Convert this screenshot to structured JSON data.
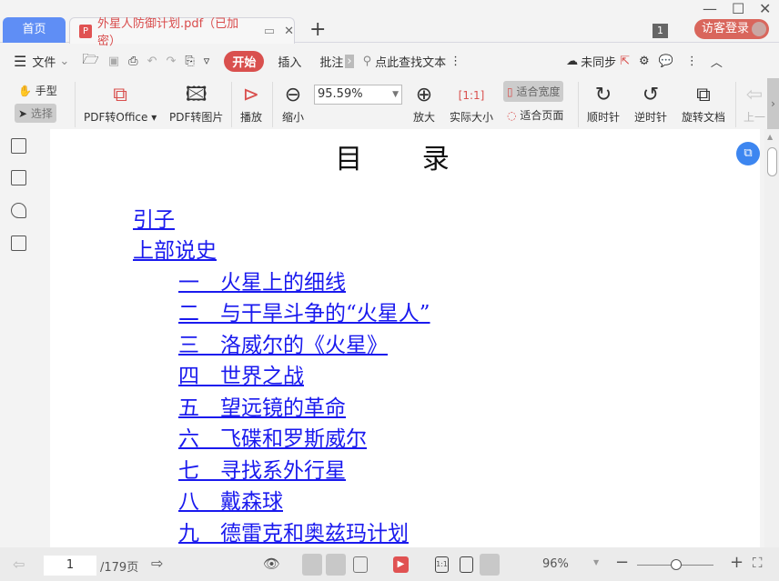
{
  "tabs": {
    "home": "首页",
    "doc": "外星人防御计划.pdf（已加密）",
    "new": "+"
  },
  "titlebar": {
    "badge": "1",
    "login": "访客登录"
  },
  "menu": {
    "file": "文件",
    "start": "开始",
    "insert": "插入",
    "annotate": "批注",
    "search": "点此查找文本",
    "sync": "未同步"
  },
  "ribbon": {
    "hand": "手型",
    "select": "选择",
    "pdf_office": "PDF转Office",
    "pdf_image": "PDF转图片",
    "play": "播放",
    "zoom_out": "缩小",
    "zoom_value": "95.59%",
    "zoom_in": "放大",
    "actual_size": "实际大小",
    "fit_width": "适合宽度",
    "fit_page": "适合页面",
    "clockwise": "顺时针",
    "counter_clockwise": "逆时针",
    "rotate_doc": "旋转文档",
    "prev": "上一"
  },
  "document": {
    "title": "目 录",
    "entries": [
      "引子",
      "上部说史",
      "一　火星上的细线",
      "二　与干旱斗争的“火星人”",
      "三　洛威尔的《火星》",
      "四　世界之战",
      "五　望远镜的革命",
      "六　飞碟和罗斯威尔",
      "七　寻找系外行星",
      "八　戴森球",
      "九　德雷克和奥兹玛计划"
    ]
  },
  "status": {
    "page": "1",
    "total": "/179页",
    "zoom": "96%"
  }
}
